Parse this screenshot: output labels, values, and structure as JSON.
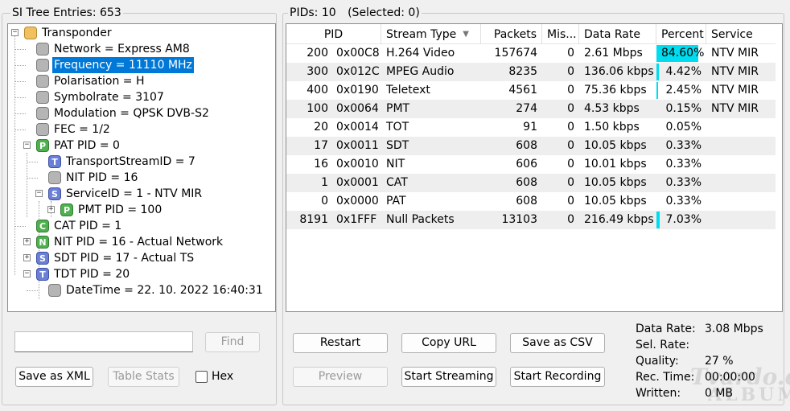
{
  "left_header": "SI Tree Entries: 653",
  "right_header": {
    "pids": "PIDs: 10",
    "selected": "(Selected: 0)"
  },
  "tree": [
    {
      "label": "Transponder",
      "icon": "folder-icon",
      "icon_text": ""
    },
    {
      "label": "Network = Express AM8",
      "icon": "node-icon",
      "icon_text": ""
    },
    {
      "label": "Frequency = 11110 MHz",
      "icon": "node-icon",
      "icon_text": ""
    },
    {
      "label": "Polarisation = H",
      "icon": "node-icon",
      "icon_text": ""
    },
    {
      "label": "Symbolrate = 3107",
      "icon": "node-icon",
      "icon_text": ""
    },
    {
      "label": "Modulation = QPSK DVB-S2",
      "icon": "node-icon",
      "icon_text": ""
    },
    {
      "label": "FEC = 1/2",
      "icon": "node-icon",
      "icon_text": ""
    },
    {
      "label": "PAT PID = 0",
      "icon": "pat-icon",
      "icon_text": "P"
    },
    {
      "label": "TransportStreamID = 7",
      "icon": "table-t-icon",
      "icon_text": "T"
    },
    {
      "label": "NIT PID = 16",
      "icon": "node-icon",
      "icon_text": ""
    },
    {
      "label": "ServiceID = 1 - NTV MIR",
      "icon": "service-icon",
      "icon_text": "S"
    },
    {
      "label": "PMT PID = 100",
      "icon": "pmt-icon",
      "icon_text": "P"
    },
    {
      "label": "CAT PID = 1",
      "icon": "cat-icon",
      "icon_text": "C"
    },
    {
      "label": "NIT PID = 16 - Actual Network",
      "icon": "nit-icon",
      "icon_text": "N"
    },
    {
      "label": "SDT PID = 17 - Actual TS",
      "icon": "sdt-icon",
      "icon_text": "S"
    },
    {
      "label": "TDT PID = 20",
      "icon": "tdt-icon",
      "icon_text": "T"
    },
    {
      "label": "DateTime = 22. 10. 2022 16:40:31",
      "icon": "node-icon",
      "icon_text": ""
    }
  ],
  "table": {
    "columns": [
      "PID",
      "Stream Type",
      "Packets",
      "Mis...",
      "Data Rate",
      "Percent",
      "Service"
    ],
    "rows": [
      {
        "pid": "200",
        "hex": "0x00C8",
        "type": "H.264 Video",
        "packets": "157674",
        "mis": "0",
        "rate": "2.61 Mbps",
        "percent": "84.60%",
        "pct_value": 84.6,
        "service": "NTV MIR"
      },
      {
        "pid": "300",
        "hex": "0x012C",
        "type": "MPEG Audio",
        "packets": "8235",
        "mis": "0",
        "rate": "136.06 kbps",
        "percent": "4.42%",
        "pct_value": 4.42,
        "service": "NTV MIR"
      },
      {
        "pid": "400",
        "hex": "0x0190",
        "type": "Teletext",
        "packets": "4561",
        "mis": "0",
        "rate": "75.36 kbps",
        "percent": "2.45%",
        "pct_value": 2.45,
        "service": "NTV MIR"
      },
      {
        "pid": "100",
        "hex": "0x0064",
        "type": "PMT",
        "packets": "274",
        "mis": "0",
        "rate": "4.53 kbps",
        "percent": "0.15%",
        "pct_value": 0.15,
        "service": "NTV MIR"
      },
      {
        "pid": "20",
        "hex": "0x0014",
        "type": "TOT",
        "packets": "91",
        "mis": "0",
        "rate": "1.50 kbps",
        "percent": "0.05%",
        "pct_value": 0.05,
        "service": ""
      },
      {
        "pid": "17",
        "hex": "0x0011",
        "type": "SDT",
        "packets": "608",
        "mis": "0",
        "rate": "10.05 kbps",
        "percent": "0.33%",
        "pct_value": 0.33,
        "service": ""
      },
      {
        "pid": "16",
        "hex": "0x0010",
        "type": "NIT",
        "packets": "606",
        "mis": "0",
        "rate": "10.01 kbps",
        "percent": "0.33%",
        "pct_value": 0.33,
        "service": ""
      },
      {
        "pid": "1",
        "hex": "0x0001",
        "type": "CAT",
        "packets": "608",
        "mis": "0",
        "rate": "10.05 kbps",
        "percent": "0.33%",
        "pct_value": 0.33,
        "service": ""
      },
      {
        "pid": "0",
        "hex": "0x0000",
        "type": "PAT",
        "packets": "608",
        "mis": "0",
        "rate": "10.05 kbps",
        "percent": "0.33%",
        "pct_value": 0.33,
        "service": ""
      },
      {
        "pid": "8191",
        "hex": "0x1FFF",
        "type": "Null Packets",
        "packets": "13103",
        "mis": "0",
        "rate": "216.49 kbps",
        "percent": "7.03%",
        "pct_value": 7.03,
        "service": ""
      }
    ]
  },
  "left_controls": {
    "search_value": "",
    "find": "Find",
    "save_xml": "Save as XML",
    "table_stats": "Table Stats",
    "hex": "Hex"
  },
  "buttons": {
    "restart": "Restart",
    "copy_url": "Copy URL",
    "save_csv": "Save as CSV",
    "preview": "Preview",
    "start_streaming": "Start Streaming",
    "start_recording": "Start Recording"
  },
  "stats": {
    "data_rate_label": "Data Rate:",
    "data_rate_value": "3.08 Mbps",
    "sel_rate_label": "Sel. Rate:",
    "sel_rate_value": "",
    "quality_label": "Quality:",
    "quality_value": "27 %",
    "rec_time_label": "Rec. Time:",
    "rec_time_value": "00:00:00",
    "written_label": "Written:",
    "written_value": "0 MB"
  },
  "watermark": {
    "line1": "Tvardo.cz",
    "line2": "ALBUM"
  },
  "colors": {
    "selection": "#0078d7",
    "percent_bar": "#00dcef"
  }
}
